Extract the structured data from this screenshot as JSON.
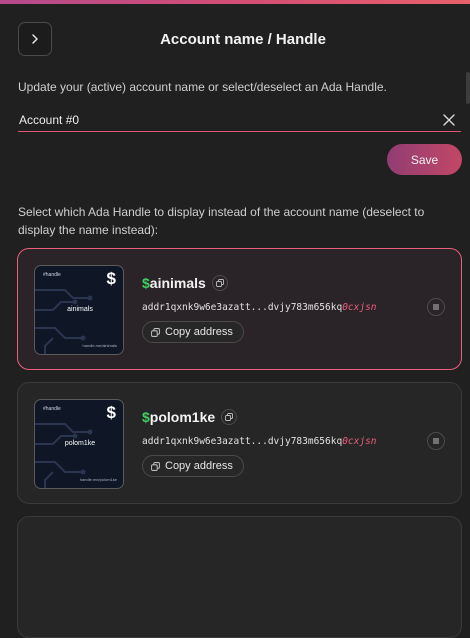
{
  "header": {
    "title": "Account name / Handle",
    "back_icon": "chevron-right-icon"
  },
  "account_form": {
    "description": "Update your (active) account name or select/deselect an Ada Handle.",
    "name_value": "Account #0",
    "clear_icon": "close-icon",
    "save_label": "Save"
  },
  "handles_section": {
    "description": "Select which Ada Handle to display instead of the account name (deselect to display the name instead):",
    "items": [
      {
        "dollar": "$",
        "name": "ainimals",
        "selected": true,
        "address_prefix": "addr1qxnk9w6e3azatt...dvjy783m656kq",
        "address_suffix": "0cxjsn",
        "copy_label": "Copy address",
        "thumb_brand": "#handle",
        "thumb_dollar": "$",
        "thumb_name": "ainimals",
        "thumb_url": "handle.me/ainimals"
      },
      {
        "dollar": "$",
        "name": "polom1ke",
        "selected": false,
        "address_prefix": "addr1qxnk9w6e3azatt...dvjy783m656kq",
        "address_suffix": "0cxjsn",
        "copy_label": "Copy address",
        "thumb_brand": "#handle",
        "thumb_dollar": "$",
        "thumb_name": "polom1ke",
        "thumb_url": "handle.me/polom1ke"
      }
    ]
  },
  "colors": {
    "accent": "#e8607c",
    "handle_dollar": "#3fcf5f",
    "background": "#202020"
  }
}
